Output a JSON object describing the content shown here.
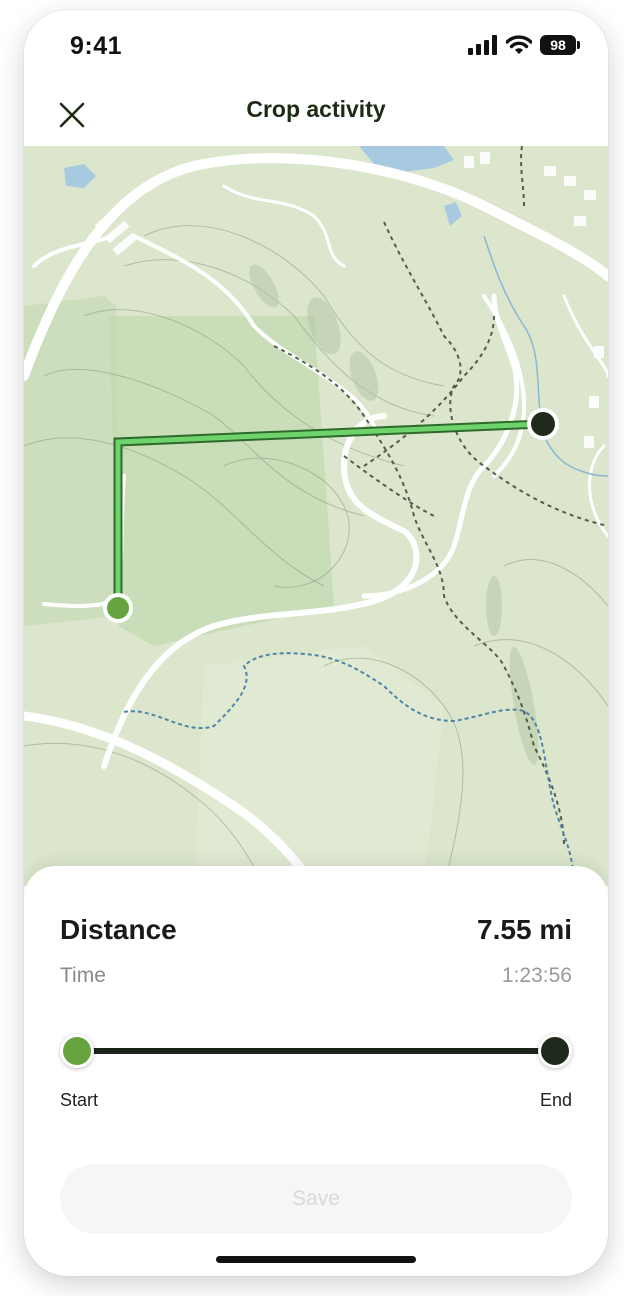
{
  "status_bar": {
    "time": "9:41",
    "battery": "98",
    "icons": [
      "cellular-signal-icon",
      "wifi-icon",
      "battery-icon"
    ]
  },
  "header": {
    "title": "Crop activity",
    "close_icon": "close-icon"
  },
  "colors": {
    "route": "#6fd36b",
    "start_marker": "#66a43f",
    "end_marker": "#1f2a1c",
    "map_background": "#dbe6cd",
    "save_text_disabled": "#d9d9d9"
  },
  "stats": {
    "distance_label": "Distance",
    "distance_value": "7.55 mi",
    "time_label": "Time",
    "time_value": "1:23:56"
  },
  "slider": {
    "start_label": "Start",
    "end_label": "End",
    "range_start": 0,
    "range_end": 1
  },
  "actions": {
    "save_label": "Save",
    "save_enabled": false
  }
}
